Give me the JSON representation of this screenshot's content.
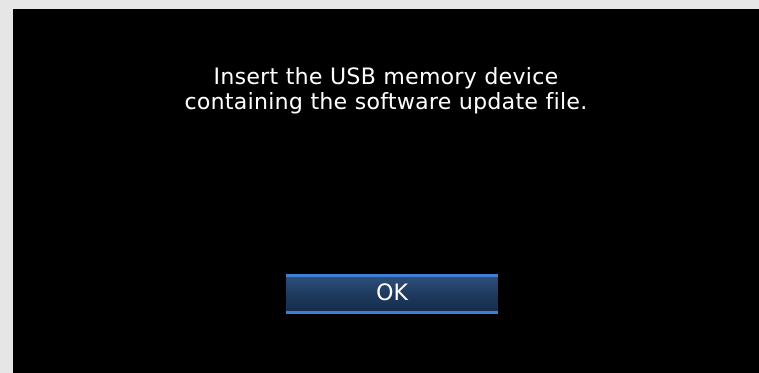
{
  "dialog": {
    "message_line_1": "Insert the USB memory device",
    "message_line_2": "containing the software update file.",
    "ok_label": "OK"
  },
  "colors": {
    "screen_background": "#000000",
    "button_highlight": "#3d7fd2",
    "button_fill": "#1f3b60",
    "text": "#ffffff"
  }
}
